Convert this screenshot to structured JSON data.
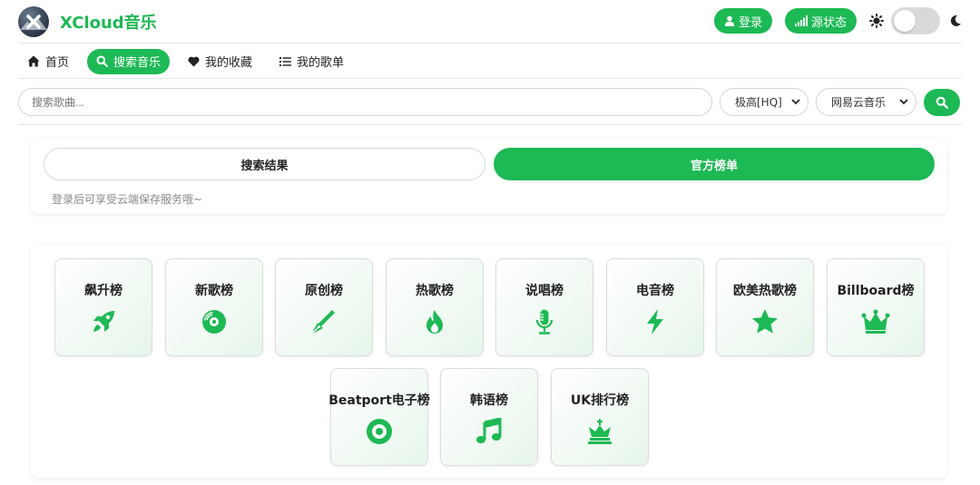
{
  "header": {
    "app_title": "XCloud音乐",
    "login_label": "登录",
    "source_status_label": "源状态"
  },
  "nav": {
    "items": [
      {
        "label": "首页",
        "icon": "home-icon",
        "active": false
      },
      {
        "label": "搜索音乐",
        "icon": "search-icon",
        "active": true
      },
      {
        "label": "我的收藏",
        "icon": "heart-icon",
        "active": false
      },
      {
        "label": "我的歌单",
        "icon": "list-icon",
        "active": false
      }
    ]
  },
  "search": {
    "placeholder": "搜索歌曲...",
    "quality_selected": "极高[HQ]",
    "source_selected": "网易云音乐"
  },
  "tabs": {
    "search_results": "搜索结果",
    "official_charts": "官方榜单",
    "tip": "登录后可享受云端保存服务哦~"
  },
  "charts": [
    {
      "name": "飙升榜",
      "icon": "rocket-icon"
    },
    {
      "name": "新歌榜",
      "icon": "disc-icon"
    },
    {
      "name": "原创榜",
      "icon": "pen-icon"
    },
    {
      "name": "热歌榜",
      "icon": "fire-icon"
    },
    {
      "name": "说唱榜",
      "icon": "microphone-icon"
    },
    {
      "name": "电音榜",
      "icon": "bolt-icon"
    },
    {
      "name": "欧美热歌榜",
      "icon": "star-icon"
    },
    {
      "name": "Billboard榜",
      "icon": "crown-icon"
    },
    {
      "name": "Beatport电子榜",
      "icon": "record-icon"
    },
    {
      "name": "韩语榜",
      "icon": "music-note-icon"
    },
    {
      "name": "UK排行榜",
      "icon": "chess-king-icon"
    }
  ],
  "colors": {
    "accent": "#1db954",
    "border": "#dcdcdc",
    "tile_tint": "#e6f5ea"
  }
}
